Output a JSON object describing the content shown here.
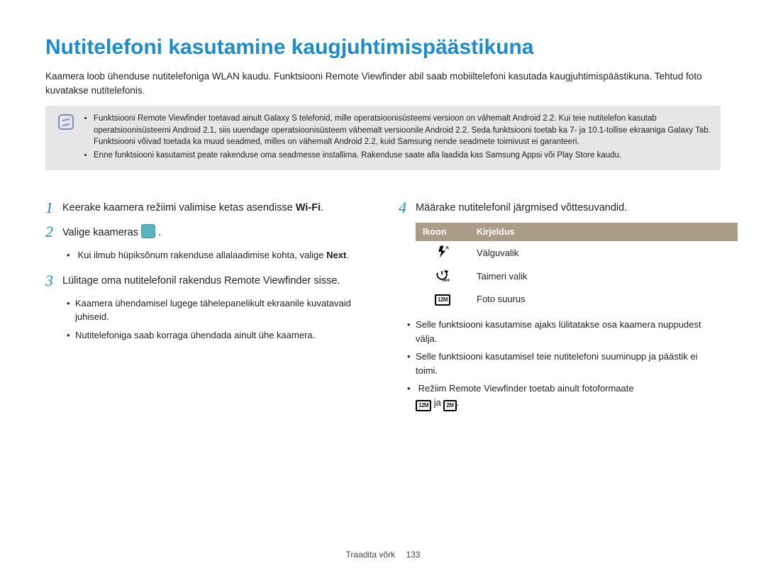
{
  "title": "Nutitelefoni kasutamine kaugjuhtimispäästikuna",
  "intro": "Kaamera loob ühenduse nutitelefoniga WLAN kaudu. Funktsiooni Remote Viewfinder abil saab mobiiltelefoni kasutada kaugjuhtimispäästikuna. Tehtud foto kuvatakse nutitelefonis.",
  "notes": [
    "Funktsiooni Remote Viewfinder toetavad ainult Galaxy S telefonid, mille operatsioonisüsteemi versioon on vähemalt Android 2.2. Kui teie nutitelefon kasutab operatsioonisüsteemi Android 2.1, siis uuendage operatsioonisüsteem vähemalt versioonile Android 2.2. Seda funktsiooni toetab ka 7- ja 10.1-tollise ekraaniga Galaxy Tab. Funktsiooni võivad toetada ka muud seadmed, milles on vähemalt Android 2.2, kuid Samsung nende seadmete toimivust ei garanteeri.",
    "Enne funktsiooni kasutamist peate rakenduse oma seadmesse installima. Rakenduse saate alla laadida kas Samsung Appsi või Play Store kaudu."
  ],
  "steps_left": [
    {
      "num": "1",
      "text_pre": "Keerake kaamera režiimi valimise ketas asendisse ",
      "bold": "Wi-Fi",
      "text_post": "."
    },
    {
      "num": "2",
      "text_pre": "Valige kaameras ",
      "icon": true,
      "text_post": " ."
    },
    {
      "num": "3",
      "text_pre": "Lülitage oma nutitelefonil rakendus Remote Viewfinder sisse.",
      "bold": "",
      "text_post": ""
    }
  ],
  "sub_left_a": [
    {
      "pre": "Kui ilmub hüpiksõnum rakenduse allalaadimise kohta, valige ",
      "bold": "Next",
      "post": "."
    }
  ],
  "sub_left_b": [
    {
      "text": "Kaamera ühendamisel lugege tähelepanelikult ekraanile kuvatavaid juhiseid."
    },
    {
      "text": "Nutitelefoniga saab korraga ühendada ainult ühe kaamera."
    }
  ],
  "steps_right": [
    {
      "num": "4",
      "text": "Määrake nutitelefonil järgmised võttesuvandid."
    }
  ],
  "table": {
    "headers": [
      "Ikoon",
      "Kirjeldus"
    ],
    "rows": [
      {
        "icon": "flash",
        "desc": "Välguvalik"
      },
      {
        "icon": "timer",
        "desc": "Taimeri valik"
      },
      {
        "icon": "size",
        "desc": "Foto suurus"
      }
    ]
  },
  "sub_right": [
    "Selle funktsiooni kasutamise ajaks lülitatakse osa kaamera nuppudest välja.",
    "Selle funktsiooni kasutamisel teie nutitelefoni suuminupp ja päästik ei toimi."
  ],
  "sub_right_last": {
    "pre": "Režiim Remote Viewfinder toetab ainult fotoformaate ",
    "mid": " ja ",
    "post": "."
  },
  "size_label_1": "12M",
  "size_label_2": "2M",
  "footer_section": "Traadita võrk",
  "footer_page": "133"
}
